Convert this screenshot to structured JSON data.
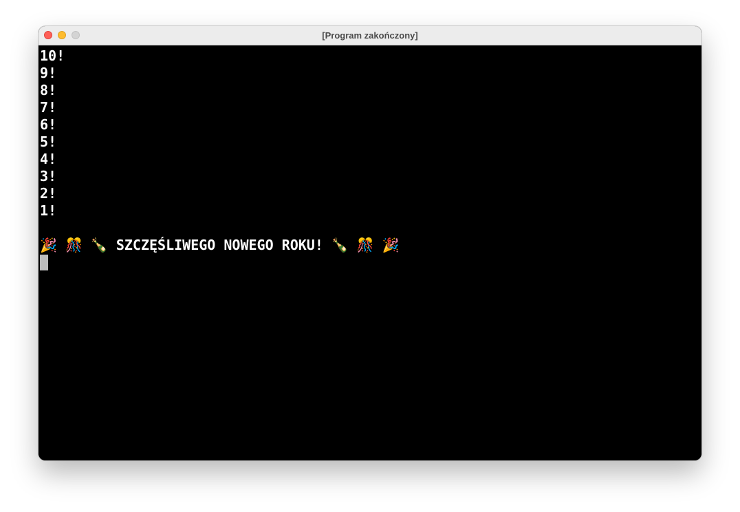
{
  "window": {
    "title": "[Program zakończony]"
  },
  "terminal": {
    "lines": [
      "10!",
      "9!",
      "8!",
      "7!",
      "6!",
      "5!",
      "4!",
      "3!",
      "2!",
      "1!",
      "",
      "🎉 🎊 🍾 SZCZĘŚLIWEGO NOWEGO ROKU! 🍾 🎊 🎉"
    ]
  },
  "colors": {
    "background": "#000000",
    "text": "#ffffff",
    "cursor": "#bdbdbd",
    "titlebar": "#ececec",
    "close_button": "#fe5f57",
    "minimize_button": "#febc2e",
    "zoom_button": "#d4d4d4"
  }
}
